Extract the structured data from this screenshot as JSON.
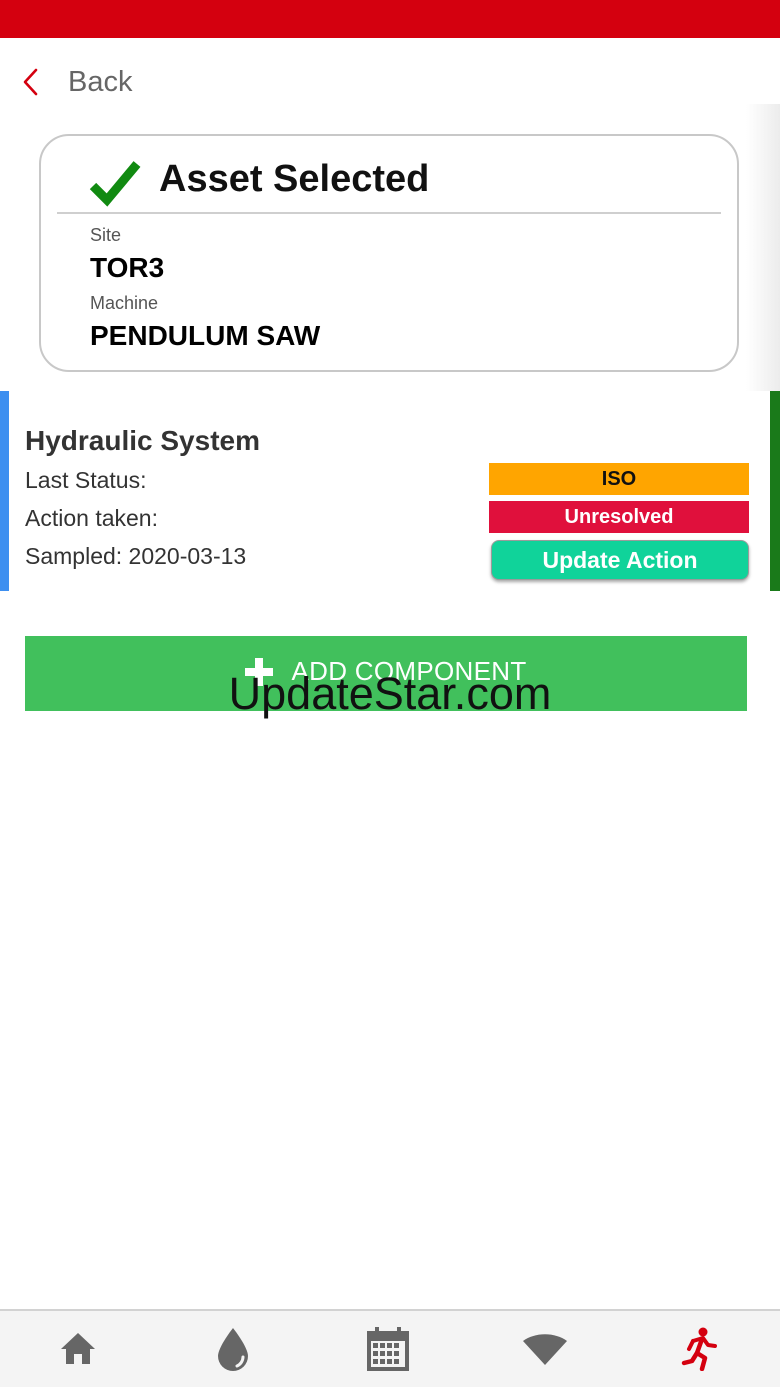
{
  "colors": {
    "top_bar": "#d4000f",
    "accent_red": "#d4000f",
    "check_green": "#118a11",
    "iso_badge": "#ffa500",
    "unresolved_badge": "#e0103c",
    "update_button": "#10d39a",
    "add_button": "#41c05c",
    "left_accent": "#3d8ff0",
    "right_accent": "#1a7a1a",
    "nav_icon": "#666666"
  },
  "nav": {
    "back_label": "Back"
  },
  "asset": {
    "title": "Asset Selected",
    "site_label": "Site",
    "site_value": "TOR3",
    "machine_label": "Machine",
    "machine_value": "PENDULUM SAW"
  },
  "component": {
    "title": "Hydraulic System",
    "last_status_label": "Last Status:",
    "last_status_value": "ISO",
    "action_label": "Action taken:",
    "action_value": "Unresolved",
    "sampled_label": "Sampled: 2020-03-13",
    "update_button_label": "Update Action"
  },
  "add_component_label": "ADD COMPONENT",
  "watermark": "UpdateStar.com",
  "bottom_nav": {
    "items": [
      {
        "icon": "home-icon"
      },
      {
        "icon": "drop-icon"
      },
      {
        "icon": "calendar-icon"
      },
      {
        "icon": "wifi-icon"
      },
      {
        "icon": "running-person-icon",
        "active": true
      }
    ]
  }
}
